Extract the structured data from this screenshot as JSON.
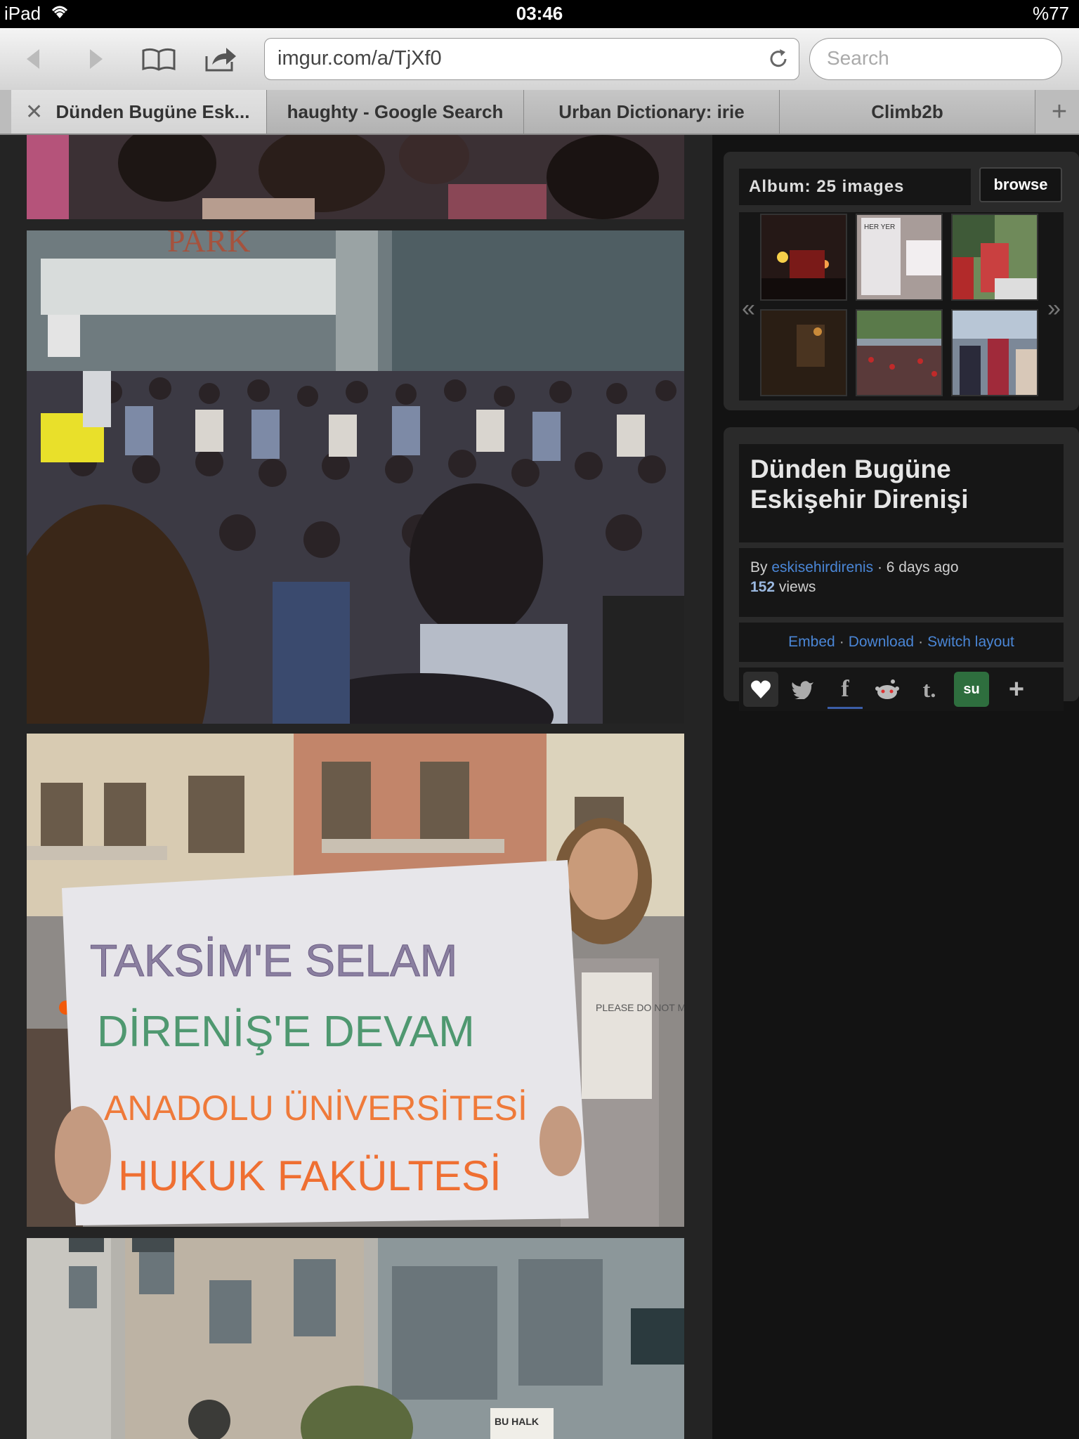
{
  "status_bar": {
    "device": "iPad",
    "time": "03:46",
    "battery": "%77"
  },
  "toolbar": {
    "url": "imgur.com/a/TjXf0",
    "search_placeholder": "Search"
  },
  "tabs": [
    {
      "label": "Dünden Bugüne Esk...",
      "active": true
    },
    {
      "label": "haughty - Google Search",
      "active": false
    },
    {
      "label": "Urban Dictionary: irie",
      "active": false
    },
    {
      "label": "Climb2b",
      "active": false
    }
  ],
  "album": {
    "header": "Album: 25 images",
    "browse_label": "browse",
    "prev_arrow": "«",
    "next_arrow": "»"
  },
  "photos": {
    "sign_lines": [
      "TAKSİM'E SELAM",
      "DİRENİŞ'E DEVAM",
      "ANADOLU ÜNİVERSİTESİ",
      "HUKUK FAKÜLTESİ"
    ],
    "mall_sign": "PARK",
    "banner_text": "BU HALK",
    "shirt_text": "PLEASE DO NOT MOVE"
  },
  "info": {
    "title_line1": "Dünden Bugüne",
    "title_line2": "Eskişehir Direnişi",
    "by_label": "By",
    "author": "eskisehirdirenis",
    "time_ago": "· 6 days ago",
    "views_count": "152",
    "views_label": "views",
    "links": {
      "embed": "Embed",
      "download": "Download",
      "switch_layout": "Switch layout",
      "separator": "·"
    }
  },
  "social": {
    "facebook": "f",
    "tumblr": "t.",
    "stumbleupon": "su",
    "more": "+"
  },
  "colors": {
    "accent_link": "#4a86d6",
    "panel_bg": "#2a2a2a",
    "page_bg": "#242424"
  }
}
